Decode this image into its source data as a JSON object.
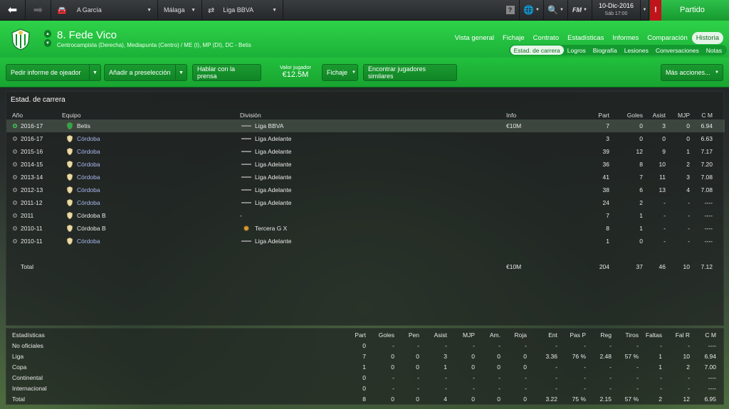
{
  "topbar": {
    "back_icon": "arrow-left-icon",
    "forward_icon": "arrow-right-icon",
    "manager": "A García",
    "club": "Málaga",
    "competition": "Liga BBVA",
    "date": "10-Dic-2016",
    "day": "Sáb 17:00",
    "continue_label": "Partido",
    "fm_label": "FM"
  },
  "player": {
    "name": "8. Fede Vico",
    "positions": "Centrocampista (Derecha), Mediapunta (Centro) / ME (I), MP (DI), DC - Betis"
  },
  "nav_main": [
    "Vista general",
    "Fichaje",
    "Contrato",
    "Estadísticas",
    "Informes",
    "Comparación",
    "Historia"
  ],
  "nav_sub": [
    "Estad. de carrera",
    "Logros",
    "Biografía",
    "Lesiones",
    "Conversaciones",
    "Notas"
  ],
  "actions": {
    "scout": "Pedir informe de ojeador",
    "shortlist": "Añadir a preselección",
    "press": "Hablar con la prensa",
    "value_label": "Valor jugador",
    "value": "€12.5M",
    "transfer": "Fichaje",
    "similar": "Encontrar jugadores similares",
    "more": "Más acciones..."
  },
  "career": {
    "title": "Estad. de carrera",
    "headers": {
      "year": "Año",
      "team": "Equipo",
      "division": "División",
      "info": "Info",
      "apps": "Part",
      "goals": "Goles",
      "assists": "Asist",
      "mom": "MJP",
      "rating": "C M"
    },
    "rows": [
      {
        "year": "2016-17",
        "team": "Betis",
        "division": "Liga BBVA",
        "info": "€10M",
        "apps": "7",
        "goals": "0",
        "assists": "3",
        "mom": "0",
        "rating": "6.94"
      },
      {
        "year": "2016-17",
        "team": "Córdoba",
        "division": "Liga Adelante",
        "info": "",
        "apps": "3",
        "goals": "0",
        "assists": "0",
        "mom": "0",
        "rating": "6.63"
      },
      {
        "year": "2015-16",
        "team": "Córdoba",
        "division": "Liga Adelante",
        "info": "",
        "apps": "39",
        "goals": "12",
        "assists": "9",
        "mom": "1",
        "rating": "7.17"
      },
      {
        "year": "2014-15",
        "team": "Córdoba",
        "division": "Liga Adelante",
        "info": "",
        "apps": "36",
        "goals": "8",
        "assists": "10",
        "mom": "2",
        "rating": "7.20"
      },
      {
        "year": "2013-14",
        "team": "Córdoba",
        "division": "Liga Adelante",
        "info": "",
        "apps": "41",
        "goals": "7",
        "assists": "11",
        "mom": "3",
        "rating": "7.08"
      },
      {
        "year": "2012-13",
        "team": "Córdoba",
        "division": "Liga Adelante",
        "info": "",
        "apps": "38",
        "goals": "6",
        "assists": "13",
        "mom": "4",
        "rating": "7.08"
      },
      {
        "year": "2011-12",
        "team": "Córdoba",
        "division": "Liga Adelante",
        "info": "",
        "apps": "24",
        "goals": "2",
        "assists": "-",
        "mom": "-",
        "rating": "----"
      },
      {
        "year": "2011",
        "team": "Córdoba B",
        "division": "-",
        "info": "",
        "apps": "7",
        "goals": "1",
        "assists": "-",
        "mom": "-",
        "rating": "----"
      },
      {
        "year": "2010-11",
        "team": "Córdoba B",
        "division": "Tercera G X",
        "info": "",
        "apps": "8",
        "goals": "1",
        "assists": "-",
        "mom": "-",
        "rating": "----"
      },
      {
        "year": "2010-11",
        "team": "Córdoba",
        "division": "Liga Adelante",
        "info": "",
        "apps": "1",
        "goals": "0",
        "assists": "-",
        "mom": "-",
        "rating": "----"
      }
    ],
    "total": {
      "label": "Total",
      "info": "€10M",
      "apps": "204",
      "goals": "37",
      "assists": "46",
      "mom": "10",
      "rating": "7.12"
    }
  },
  "stats": {
    "title": "Estadísticas",
    "headers": [
      "Part",
      "Goles",
      "Pen",
      "Asist",
      "MJP",
      "Am.",
      "Roja",
      "Ent",
      "Pas P",
      "Reg",
      "Tiros",
      "Faltas",
      "Fal R",
      "C M"
    ],
    "rows": [
      {
        "label": "No oficiales",
        "values": [
          "0",
          "-",
          "-",
          "-",
          "-",
          "-",
          "-",
          "-",
          "-",
          "-",
          "-",
          "-",
          "-",
          "----"
        ]
      },
      {
        "label": "Liga",
        "values": [
          "7",
          "0",
          "0",
          "3",
          "0",
          "0",
          "0",
          "3.36",
          "76 %",
          "2.48",
          "57 %",
          "1",
          "10",
          "6.94"
        ]
      },
      {
        "label": "Copa",
        "values": [
          "1",
          "0",
          "0",
          "1",
          "0",
          "0",
          "0",
          "-",
          "-",
          "-",
          "-",
          "1",
          "2",
          "7.00"
        ]
      },
      {
        "label": "Continental",
        "values": [
          "0",
          "-",
          "-",
          "-",
          "-",
          "-",
          "-",
          "-",
          "-",
          "-",
          "-",
          "-",
          "-",
          "----"
        ]
      },
      {
        "label": "Internacional",
        "values": [
          "0",
          "-",
          "-",
          "-",
          "-",
          "-",
          "-",
          "-",
          "-",
          "-",
          "-",
          "-",
          "-",
          "----"
        ]
      },
      {
        "label": "Total",
        "values": [
          "8",
          "0",
          "0",
          "4",
          "0",
          "0",
          "0",
          "3.22",
          "75 %",
          "2.15",
          "57 %",
          "2",
          "12",
          "6.95"
        ]
      }
    ]
  }
}
